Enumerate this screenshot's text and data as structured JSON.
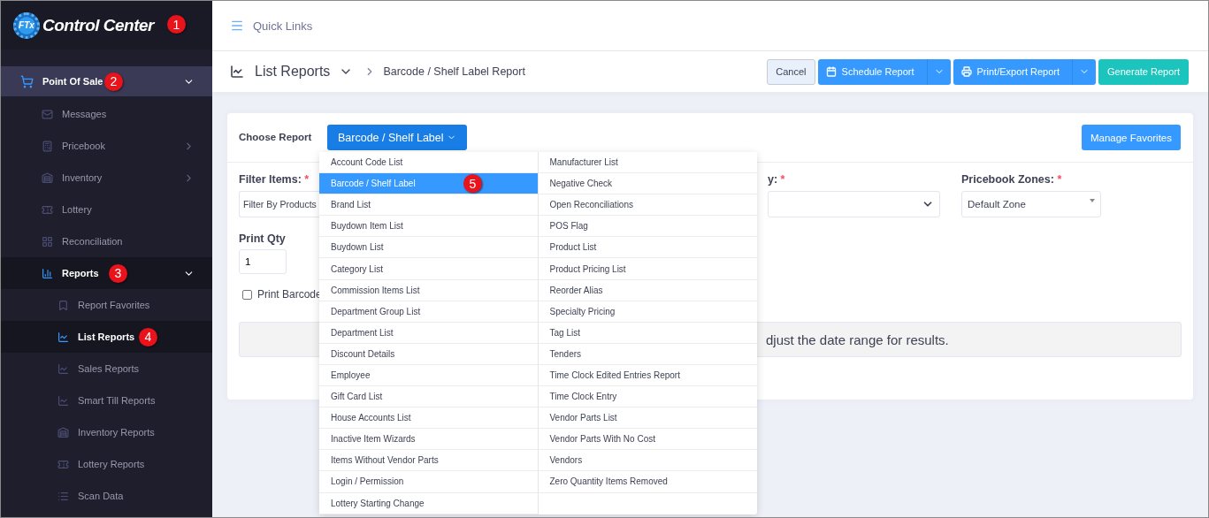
{
  "sidebar": {
    "logo": {
      "mark": "FTx",
      "title": "Control Center",
      "badge": "1"
    },
    "items": [
      {
        "label": "Point Of Sale",
        "expanded": true,
        "badge": "2",
        "children": [
          {
            "label": "Messages",
            "selected": false
          },
          {
            "label": "Pricebook",
            "expanded": false,
            "selected": false
          },
          {
            "label": "Inventory",
            "expanded": false,
            "selected": false
          },
          {
            "label": "Lottery",
            "selected": false
          },
          {
            "label": "Reconciliation",
            "selected": false
          },
          {
            "label": "Reports",
            "expanded": true,
            "badge": "3",
            "children": [
              {
                "label": "Report Favorites",
                "selected": false
              },
              {
                "label": "List Reports",
                "selected": true,
                "badge": "4"
              },
              {
                "label": "Sales Reports",
                "selected": false
              },
              {
                "label": "Smart Till Reports",
                "selected": false
              },
              {
                "label": "Inventory Reports",
                "selected": false
              },
              {
                "label": "Lottery Reports",
                "selected": false
              },
              {
                "label": "Scan Data",
                "selected": false
              }
            ]
          }
        ]
      }
    ]
  },
  "topbar": {
    "quick_links": "Quick Links"
  },
  "header": {
    "title": "List Reports",
    "breadcrumb": "Barcode / Shelf Label Report",
    "buttons": [
      {
        "label": "Cancel",
        "kind": "plain"
      },
      {
        "label": "Schedule Report",
        "kind": "split"
      },
      {
        "label": "Print/Export Report",
        "kind": "split"
      },
      {
        "label": "Generate Report",
        "kind": "success"
      }
    ]
  },
  "card": {
    "choose_report": {
      "label": "Choose Report",
      "value": "Barcode / Shelf Label",
      "expanded": true
    },
    "manage_favorites": "Manage Favorites",
    "fields": [
      {
        "label": "Filter Items:",
        "marker": "*",
        "value": "Filter By Products"
      },
      {
        "label": "y:",
        "marker": "*"
      },
      {
        "label": "Pricebook Zones:",
        "marker": "*",
        "value": "Default Zone"
      }
    ],
    "print_qty": {
      "label": "Print Qty",
      "value": "1"
    },
    "print_barcode": {
      "label": "Print Barcode",
      "checked": false
    },
    "message": "djust the date range for results.",
    "dropdown": {
      "columns": [
        {
          "items": [
            {
              "label": "Account Code List",
              "selected": false
            },
            {
              "label": "Barcode / Shelf Label",
              "selected": true,
              "badge": "5"
            },
            {
              "label": "Brand List",
              "selected": false
            },
            {
              "label": "Buydown Item List",
              "selected": false
            },
            {
              "label": "Buydown List",
              "selected": false
            },
            {
              "label": "Category List",
              "selected": false
            },
            {
              "label": "Commission Items List",
              "selected": false
            },
            {
              "label": "Department Group List",
              "selected": false
            },
            {
              "label": "Department List",
              "selected": false
            },
            {
              "label": "Discount Details",
              "selected": false
            },
            {
              "label": "Employee",
              "selected": false
            },
            {
              "label": "Gift Card List",
              "selected": false
            },
            {
              "label": "House Accounts List",
              "selected": false
            },
            {
              "label": "Inactive Item Wizards",
              "selected": false
            },
            {
              "label": "Items Without Vendor Parts",
              "selected": false
            },
            {
              "label": "Login / Permission",
              "selected": false
            },
            {
              "label": "Lottery Starting Change",
              "selected": false
            }
          ]
        },
        {
          "items": [
            {
              "label": "Manufacturer List",
              "selected": false
            },
            {
              "label": "Negative Check",
              "selected": false
            },
            {
              "label": "Open Reconciliations",
              "selected": false
            },
            {
              "label": "POS Flag",
              "selected": false
            },
            {
              "label": "Product List",
              "selected": false
            },
            {
              "label": "Product Pricing List",
              "selected": false
            },
            {
              "label": "Reorder Alias",
              "selected": false
            },
            {
              "label": "Specialty Pricing",
              "selected": false
            },
            {
              "label": "Tag List",
              "selected": false
            },
            {
              "label": "Tenders",
              "selected": false
            },
            {
              "label": "Time Clock Edited Entries Report",
              "selected": false
            },
            {
              "label": "Time Clock Entry",
              "selected": false
            },
            {
              "label": "Vendor Parts List",
              "selected": false
            },
            {
              "label": "Vendor Parts With No Cost",
              "selected": false
            },
            {
              "label": "Vendors",
              "selected": false
            },
            {
              "label": "Zero Quantity Items Removed",
              "selected": false
            }
          ]
        }
      ]
    }
  }
}
